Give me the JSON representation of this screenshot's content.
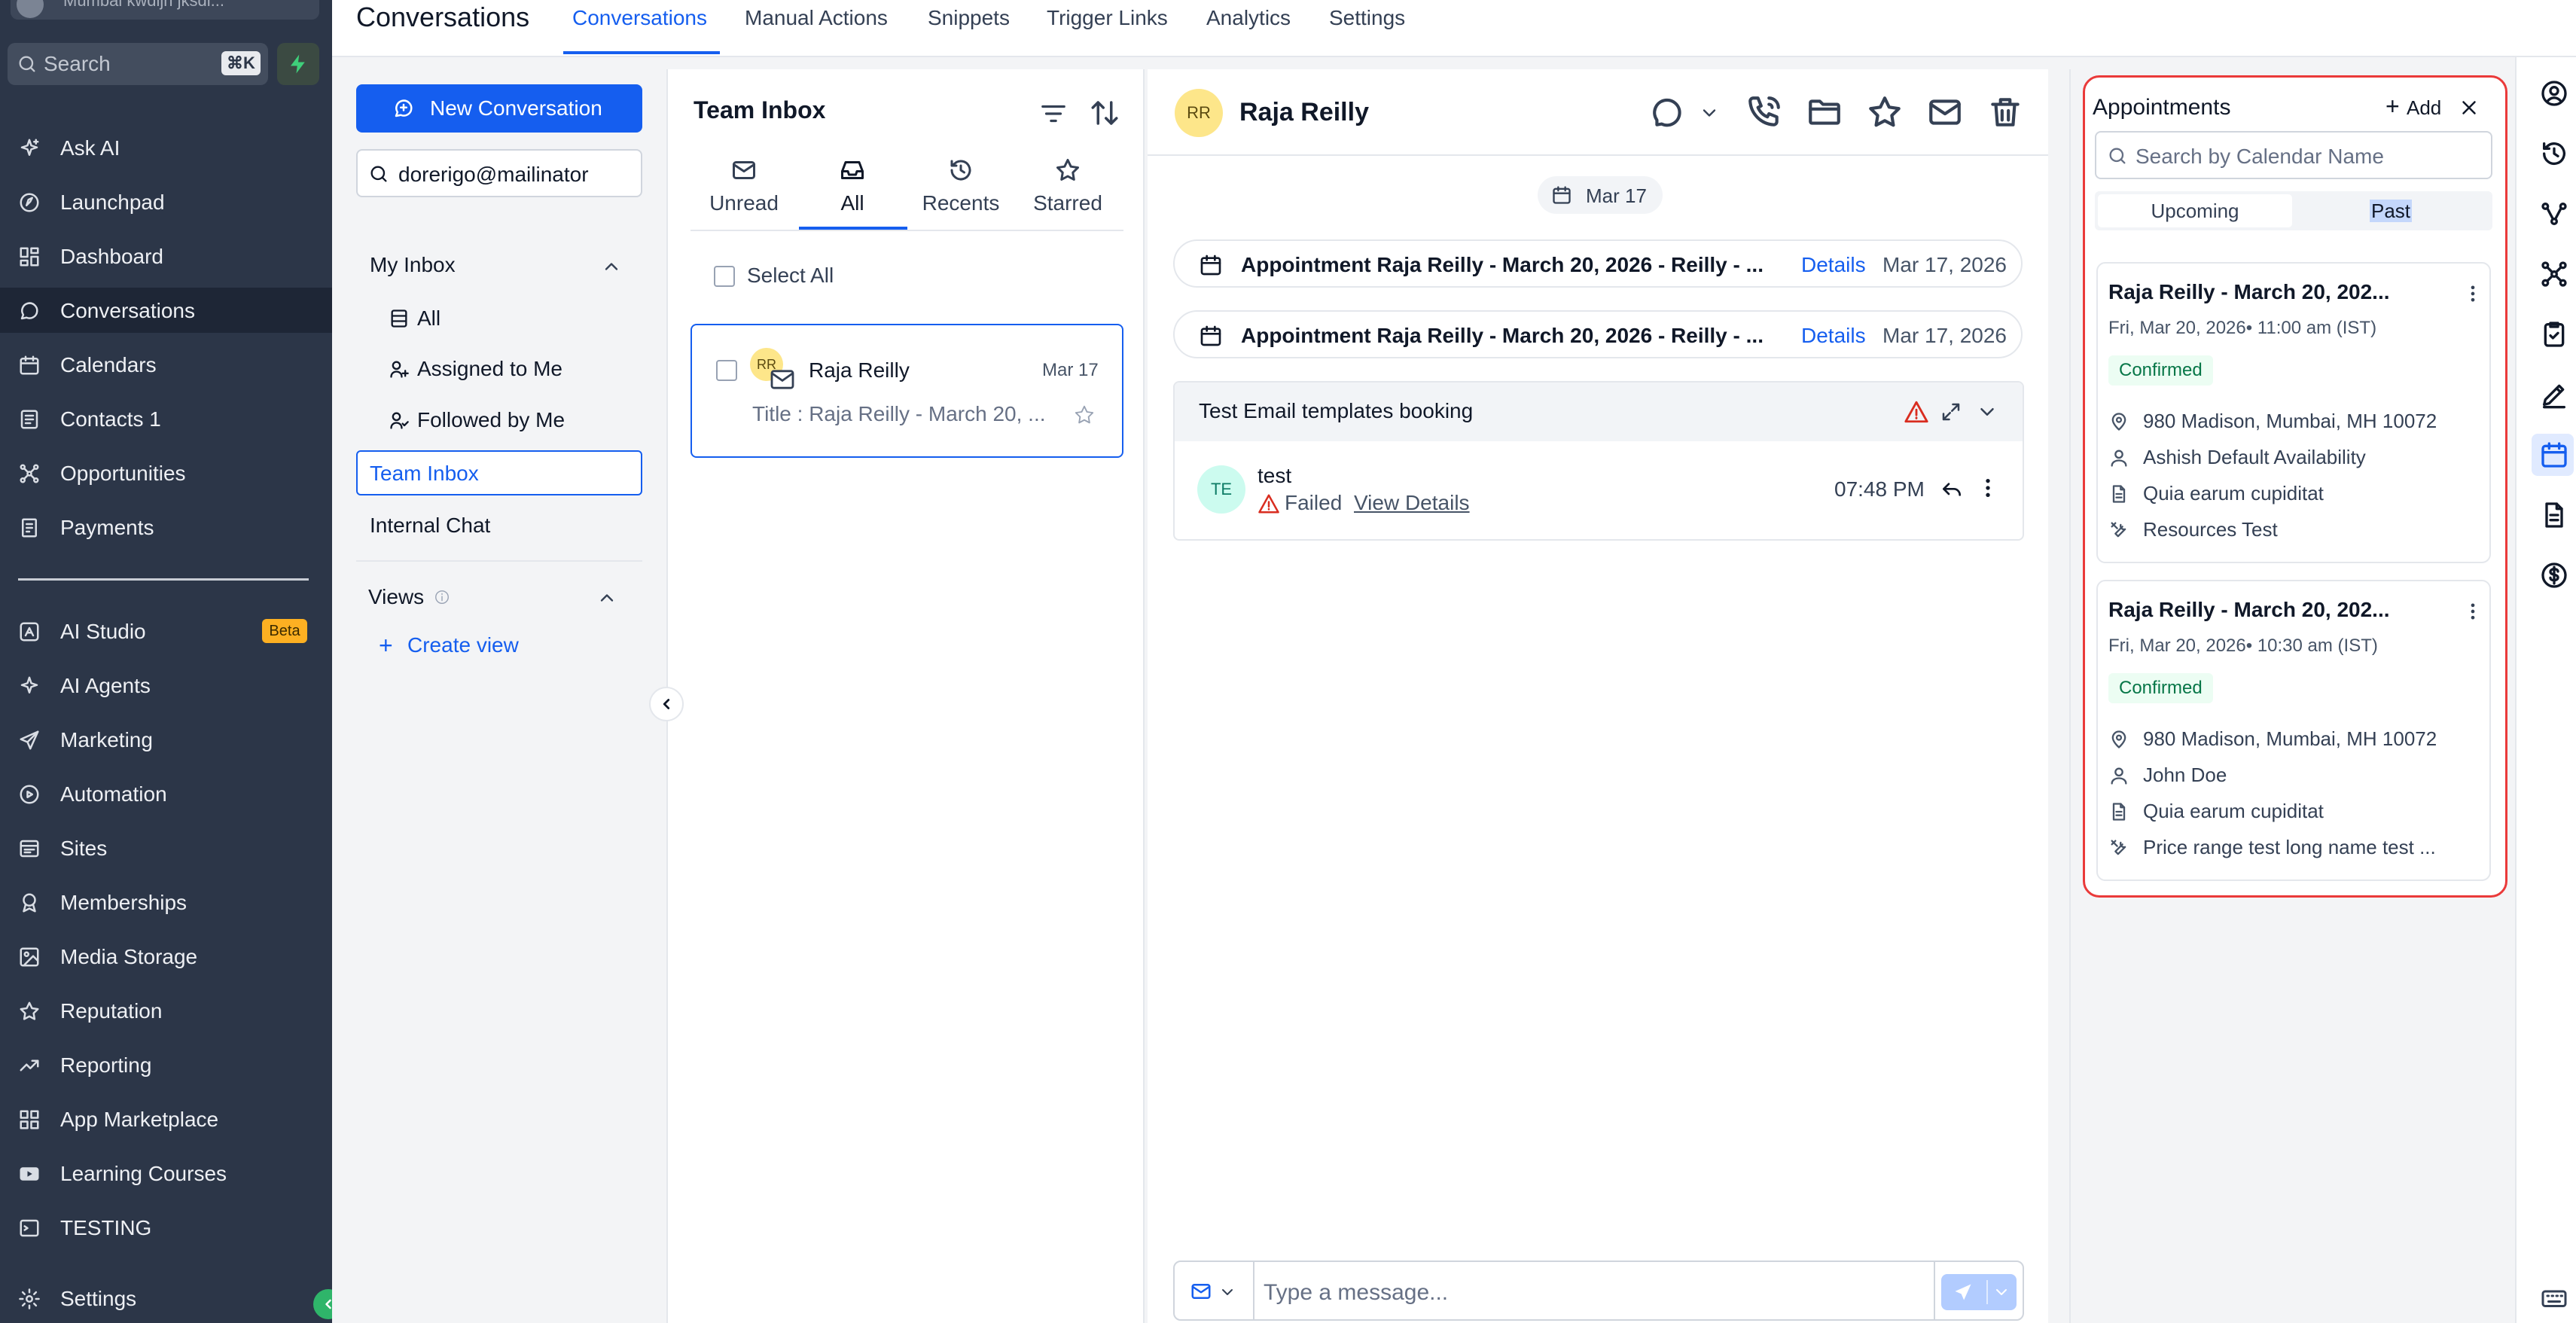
{
  "sidebar": {
    "location": "Mumbai kwdijh jksdi...",
    "search_label": "Search",
    "shortcut": "⌘K",
    "items": [
      {
        "label": "Ask AI",
        "icon": "sparkle-icon"
      },
      {
        "label": "Launchpad",
        "icon": "rocket-icon"
      },
      {
        "label": "Dashboard",
        "icon": "dashboard-icon"
      },
      {
        "label": "Conversations",
        "icon": "chat-icon",
        "active": true
      },
      {
        "label": "Calendars",
        "icon": "calendar-icon"
      },
      {
        "label": "Contacts 1",
        "icon": "contacts-icon"
      },
      {
        "label": "Opportunities",
        "icon": "opportunities-icon"
      },
      {
        "label": "Payments",
        "icon": "payments-icon"
      },
      {
        "label": "AI Studio",
        "icon": "ai-studio-icon",
        "badge": "Beta"
      },
      {
        "label": "AI Agents",
        "icon": "sparkle-icon"
      },
      {
        "label": "Marketing",
        "icon": "send-icon"
      },
      {
        "label": "Automation",
        "icon": "automation-icon"
      },
      {
        "label": "Sites",
        "icon": "sites-icon"
      },
      {
        "label": "Memberships",
        "icon": "membership-icon"
      },
      {
        "label": "Media Storage",
        "icon": "image-icon"
      },
      {
        "label": "Reputation",
        "icon": "star-icon"
      },
      {
        "label": "Reporting",
        "icon": "trending-icon"
      },
      {
        "label": "App Marketplace",
        "icon": "grid-icon"
      },
      {
        "label": "Learning Courses",
        "icon": "video-icon"
      },
      {
        "label": "TESTING",
        "icon": "terminal-icon"
      },
      {
        "label": "Settings",
        "icon": "gear-icon"
      }
    ]
  },
  "topbar": {
    "title": "Conversations",
    "tabs": [
      "Conversations",
      "Manual Actions",
      "Snippets",
      "Trigger Links",
      "Analytics",
      "Settings"
    ]
  },
  "inbox_nav": {
    "new_conversation": "New Conversation",
    "search_value": "dorerigo@mailinator",
    "my_inbox": "My Inbox",
    "my_inbox_items": [
      "All",
      "Assigned to Me",
      "Followed by Me"
    ],
    "team_inbox": "Team Inbox",
    "internal_chat": "Internal Chat",
    "views": "Views",
    "create_view": "Create view"
  },
  "list": {
    "title": "Team Inbox",
    "tabs": [
      "Unread",
      "All",
      "Recents",
      "Starred"
    ],
    "select_all": "Select All",
    "item": {
      "initials": "RR",
      "name": "Raja Reilly",
      "date": "Mar 17",
      "preview": "Title : Raja Reilly - March 20, ..."
    }
  },
  "chat": {
    "initials": "RR",
    "name": "Raja Reilly",
    "date_pill": "Mar 17",
    "appointments": [
      {
        "title": "Appointment Raja Reilly - March 20, 2026 - Reilly - ...",
        "link": "Details",
        "date": "Mar 17, 2026"
      },
      {
        "title": "Appointment Raja Reilly - March 20, 2026 - Reilly - ...",
        "link": "Details",
        "date": "Mar 17, 2026"
      }
    ],
    "email": {
      "title": "Test Email templates booking",
      "initials": "TE",
      "sender": "test",
      "status": "Failed",
      "status_link": "View Details",
      "time": "07:48 PM"
    },
    "composer_placeholder": "Type a message..."
  },
  "appointments_panel": {
    "title": "Appointments",
    "add_label": "Add",
    "search_placeholder": "Search by Calendar Name",
    "segments": [
      "Upcoming",
      "Past"
    ],
    "cards": [
      {
        "title": "Raja Reilly - March 20, 202...",
        "datetime": "Fri, Mar 20, 2026• 11:00 am (IST)",
        "status": "Confirmed",
        "address": "980 Madison, Mumbai, MH 10072",
        "user": "Ashish Default Availability",
        "calendar": "Quia earum cupiditat",
        "resource": "Resources Test"
      },
      {
        "title": "Raja Reilly - March 20, 202...",
        "datetime": "Fri, Mar 20, 2026• 10:30 am (IST)",
        "status": "Confirmed",
        "address": "980 Madison, Mumbai, MH 10072",
        "user": "John Doe",
        "calendar": "Quia earum cupiditat",
        "resource": "Price range test long name test ..."
      }
    ]
  },
  "colors": {
    "primary": "#155eef",
    "sidebar_bg": "#2c3648",
    "highlight_border": "#ea3a3a",
    "success": "#067647"
  }
}
